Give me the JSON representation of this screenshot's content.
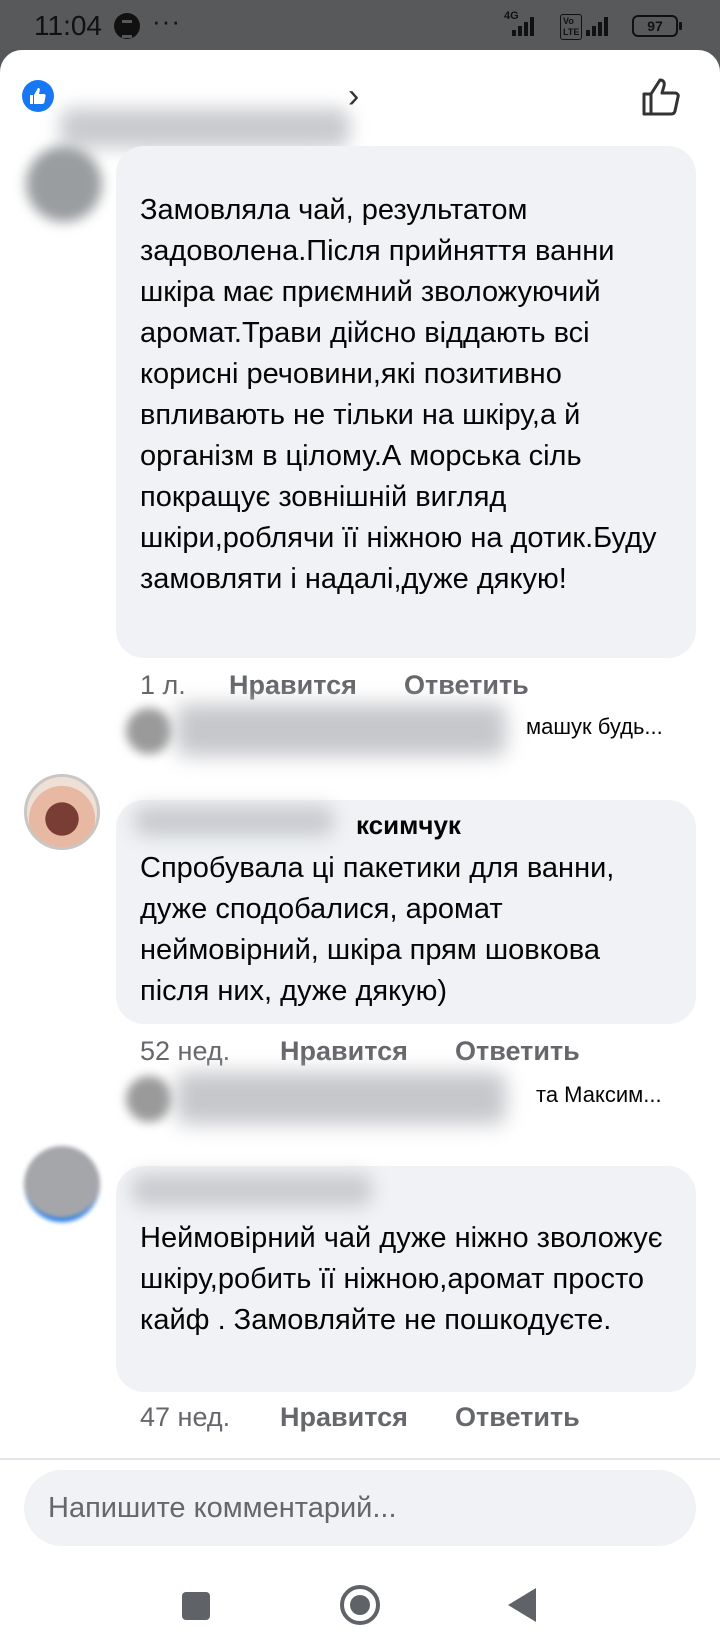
{
  "status_bar": {
    "time": "11:04",
    "dots": "···",
    "net1": "4G",
    "net2": "Vo\nLTE",
    "battery": "97"
  },
  "header": {
    "like_icon": "like-icon",
    "chevron": "›",
    "thumb_icon": "thumbs-up-outline-icon"
  },
  "comments": [
    {
      "text": "Замовляла чай, результатом задоволена.Після прийняття ванни шкіра має приємний зволожуючий аромат.Трави дійсно віддають всі корисні речовини,які позитивно впливають не тільки на шкіру,а й організм в цілому.А морська сіль покращує зовнішній вигляд шкіри,роблячи її ніжною на дотик.Буду замовляти і надалі,дуже дякую!",
      "time": "1 л.",
      "like_label": "Нравится",
      "reply_label": "Ответить",
      "reply_preview": "машук будь..."
    },
    {
      "author_partial": "ксимчук",
      "text": "Спробувала ці пакетики для ванни, дуже сподобалися, аромат неймовірний, шкіра прям шовкова після них, дуже дякую)",
      "time": "52 нед.",
      "like_label": "Нравится",
      "reply_label": "Ответить",
      "reply_preview": "та Максим..."
    },
    {
      "text": "Неймовірний чай дуже ніжно зволожує шкіру,робить її ніжною,аромат просто кайф . Замовляйте не пошкодуєте.",
      "time": "47 нед.",
      "like_label": "Нравится",
      "reply_label": "Ответить"
    }
  ],
  "composer": {
    "placeholder": "Напишите комментарий..."
  },
  "colors": {
    "accent": "#1877f2",
    "bubble": "#f0f2f5",
    "meta": "#65676b"
  }
}
